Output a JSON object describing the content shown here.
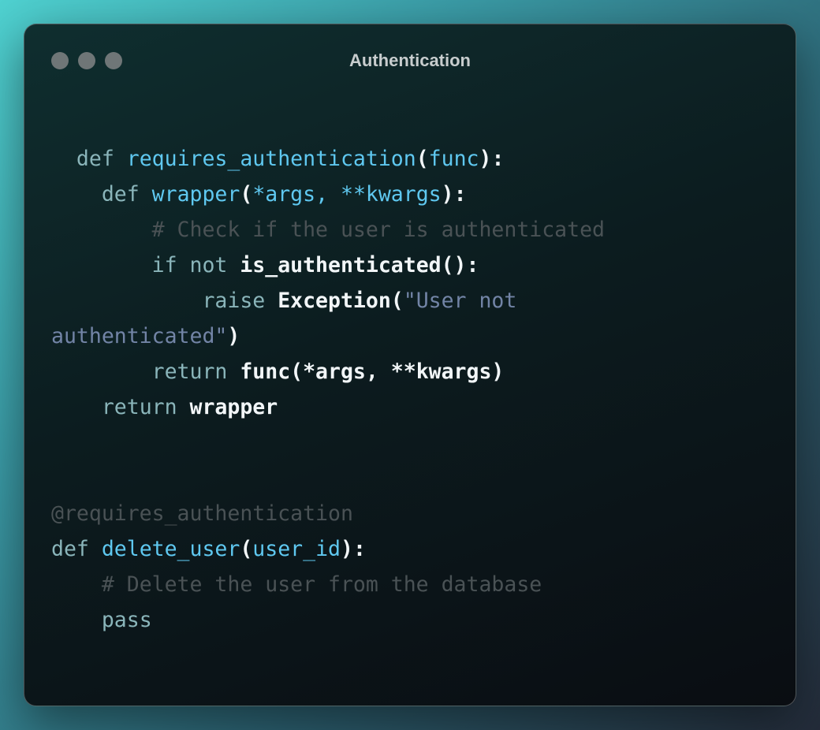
{
  "window": {
    "title": "Authentication",
    "controls": [
      "window-dot",
      "window-dot",
      "window-dot"
    ]
  },
  "code": {
    "lines": [
      {
        "indent": "  ",
        "tokens": [
          {
            "t": "kw",
            "v": "def "
          },
          {
            "t": "fn",
            "v": "requires_authentication"
          },
          {
            "t": "pn",
            "v": "("
          },
          {
            "t": "fn",
            "v": "func"
          },
          {
            "t": "pn",
            "v": "):"
          }
        ]
      },
      {
        "indent": "    ",
        "tokens": [
          {
            "t": "kw",
            "v": "def "
          },
          {
            "t": "fn",
            "v": "wrapper"
          },
          {
            "t": "pn",
            "v": "("
          },
          {
            "t": "fn",
            "v": "*args, **kwargs"
          },
          {
            "t": "pn",
            "v": "):"
          }
        ]
      },
      {
        "indent": "        ",
        "tokens": [
          {
            "t": "cm",
            "v": "# Check if the user is authenticated"
          }
        ]
      },
      {
        "indent": "        ",
        "tokens": [
          {
            "t": "kw",
            "v": "if not "
          },
          {
            "t": "nm",
            "v": "is_authenticated():"
          }
        ]
      },
      {
        "indent": "            ",
        "tokens": [
          {
            "t": "kw",
            "v": "raise "
          },
          {
            "t": "nm",
            "v": "Exception("
          },
          {
            "t": "st",
            "v": "\"User not"
          }
        ]
      },
      {
        "indent": "",
        "tokens": [
          {
            "t": "st",
            "v": "authenticated\""
          },
          {
            "t": "nm",
            "v": ")"
          }
        ]
      },
      {
        "indent": "        ",
        "tokens": [
          {
            "t": "kw",
            "v": "return "
          },
          {
            "t": "nm",
            "v": "func(*args, **kwargs)"
          }
        ]
      },
      {
        "indent": "    ",
        "tokens": [
          {
            "t": "kw",
            "v": "return "
          },
          {
            "t": "nm",
            "v": "wrapper"
          }
        ]
      },
      {
        "indent": "",
        "tokens": []
      },
      {
        "indent": "",
        "tokens": []
      },
      {
        "indent": "",
        "tokens": [
          {
            "t": "dc",
            "v": "@requires_authentication"
          }
        ]
      },
      {
        "indent": "",
        "tokens": [
          {
            "t": "kw",
            "v": "def "
          },
          {
            "t": "fn",
            "v": "delete_user"
          },
          {
            "t": "pn",
            "v": "("
          },
          {
            "t": "fn",
            "v": "user_id"
          },
          {
            "t": "pn",
            "v": "):"
          }
        ]
      },
      {
        "indent": "    ",
        "tokens": [
          {
            "t": "cm",
            "v": "# Delete the user from the database"
          }
        ]
      },
      {
        "indent": "    ",
        "tokens": [
          {
            "t": "kw",
            "v": "pass"
          }
        ]
      }
    ]
  }
}
